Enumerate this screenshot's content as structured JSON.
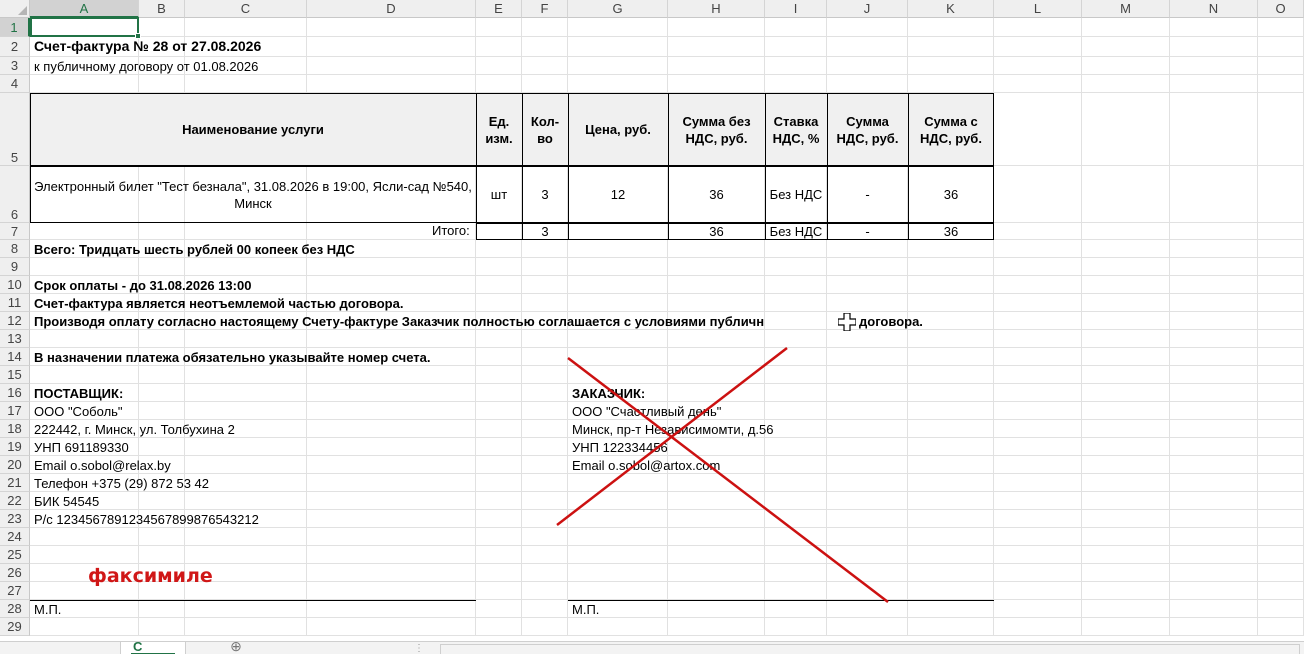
{
  "columns": [
    "A",
    "B",
    "C",
    "D",
    "E",
    "F",
    "G",
    "H",
    "I",
    "J",
    "K",
    "L",
    "M",
    "N",
    "O"
  ],
  "rows": [
    "1",
    "2",
    "3",
    "4",
    "5",
    "6",
    "7",
    "8",
    "9",
    "10",
    "11",
    "12",
    "13",
    "14",
    "15",
    "16",
    "17",
    "18",
    "19",
    "20",
    "21",
    "22",
    "23",
    "24",
    "25",
    "26",
    "27",
    "28",
    "29"
  ],
  "invoice": {
    "title": "Счет-фактура № 28 от 27.08.2026",
    "subtitle": "к публичному договору от 01.08.2026"
  },
  "table": {
    "headers": [
      "Наименование услуги",
      "Ед. изм.",
      "Кол-во",
      "Цена, руб.",
      "Сумма без НДС, руб.",
      "Ставка НДС, %",
      "Сумма НДС, руб.",
      "Сумма с НДС, руб."
    ],
    "row": {
      "name": "Электронный билет \"Тест безнала\", 31.08.2026 в 19:00, Ясли-сад №540, Минск",
      "unit": "шт",
      "qty": "3",
      "price": "12",
      "sum_wo_vat": "36",
      "vat_rate": "Без НДС",
      "vat_sum": "-",
      "sum_with_vat": "36"
    },
    "total": {
      "label": "Итого:",
      "qty": "3",
      "sum_wo_vat": "36",
      "vat_rate": "Без НДС",
      "vat_sum": "-",
      "sum_with_vat": "36"
    }
  },
  "notes": {
    "total_words": "Всего: Тридцать шесть рублей 00 копеек без НДС",
    "due": "Срок оплаты - до 31.08.2026 13:00",
    "integral": "Счет-фактура является неотъемлемой частью договора.",
    "agreement": "Производя оплату согласно настоящему Счету-фактуре Заказчик полностью соглашается с условиями публичного договора.",
    "agreement_visible": "Производя оплату согласно настоящему Счету-фактуре Заказчик полностью соглашается с условиями публичн",
    "agreement_tail": "договора.",
    "payment_ref": "В назначении платежа обязательно указывайте номер счета."
  },
  "supplier": {
    "heading": "ПОСТАВЩИК:",
    "name": "ООО \"Соболь\"",
    "address": "222442, г. Минск, ул. Толбухина 2",
    "unp": "УНП 691189330",
    "email": "Email o.sobol@relax.by",
    "phone": "Телефон +375 (29) 872 53 42",
    "bik": "БИК 54545",
    "account": "Р/с 1234567891234567899876543212",
    "stamp": "М.П."
  },
  "customer": {
    "heading": "ЗАКАЗЧИК:",
    "name": "ООО \"Счастливый день\"",
    "address": "Минск, пр-т Независимомти, д.56",
    "unp": "УНП 122334456",
    "email": "Email o.sobol@artox.com",
    "stamp": "М.П."
  },
  "facsimile": "факсимиле",
  "sheet": {
    "tab_label": "С",
    "add_icon": "plus-circle-icon"
  },
  "colors": {
    "accent": "#217346",
    "strike": "#cc1111",
    "facsimile": "#d01717",
    "header_fill": "#f0f0f0"
  }
}
